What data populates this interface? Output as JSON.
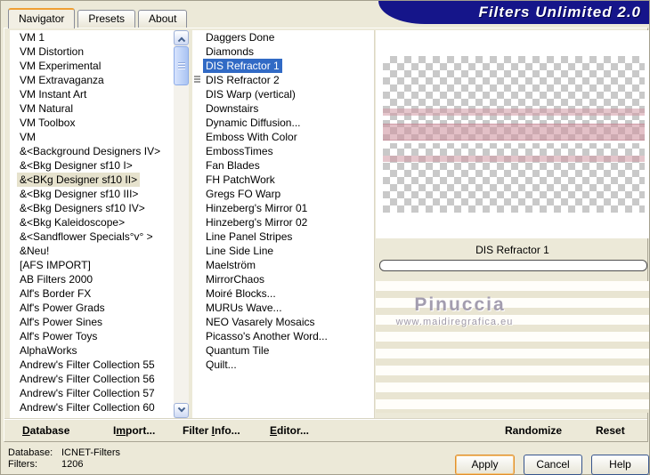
{
  "window": {
    "banner_title": "Filters Unlimited 2.0",
    "tabs": [
      {
        "label": "Navigator",
        "active": true
      },
      {
        "label": "Presets",
        "active": false
      },
      {
        "label": "About",
        "active": false
      }
    ]
  },
  "navigator": {
    "categories": {
      "items": [
        "VM 1",
        "VM Distortion",
        "VM Experimental",
        "VM Extravaganza",
        "VM Instant Art",
        "VM Natural",
        "VM Toolbox",
        "VM",
        "&<Background Designers IV>",
        "&<Bkg Designer sf10 I>",
        {
          "label": "&<BKg Designer sf10 II>",
          "selected": true
        },
        "&<Bkg Designer sf10 III>",
        "&<Bkg Designers sf10 IV>",
        "&<Bkg Kaleidoscope>",
        "&<Sandflower Specials°v° >",
        "&Neu!",
        "[AFS IMPORT]",
        "AB Filters 2000",
        "Alf's Border FX",
        "Alf's Power Grads",
        "Alf's Power Sines",
        "Alf's Power Toys",
        "AlphaWorks",
        "Andrew's Filter Collection 55",
        "Andrew's Filter Collection 56",
        "Andrew's Filter Collection 57",
        "Andrew's Filter Collection 60"
      ]
    },
    "filters": {
      "items": [
        "Daggers Done",
        "Diamonds",
        {
          "label": "DIS Refractor 1",
          "selected": true
        },
        {
          "label": "DIS Refractor 2",
          "grip": true
        },
        "DIS Warp (vertical)",
        "Downstairs",
        "Dynamic Diffusion...",
        "Emboss With Color",
        "EmbossTimes",
        "Fan Blades",
        "FH PatchWork",
        "Gregs FO Warp",
        "Hinzeberg's Mirror 01",
        "Hinzeberg's Mirror 02",
        "Line Panel Stripes",
        "Line Side Line",
        "Maelström",
        "MirrorChaos",
        "Moiré Blocks...",
        "MURUs Wave...",
        "NEO Vasarely Mosaics",
        "Picasso's Another Word...",
        "Quantum Tile",
        "Quilt..."
      ]
    },
    "preview": {
      "filter_name": "DIS Refractor 1",
      "watermark_title": "Pinuccia",
      "watermark_url": "www.maidiregrafica.eu"
    },
    "toolbar": {
      "database": {
        "pre": "",
        "key": "D",
        "post": "atabase"
      },
      "import": {
        "pre": "I",
        "key": "m",
        "post": "port..."
      },
      "filter_info": {
        "pre": "Filter ",
        "key": "I",
        "post": "nfo..."
      },
      "editor": {
        "pre": "",
        "key": "E",
        "post": "ditor..."
      },
      "randomize": "Randomize",
      "reset": "Reset"
    }
  },
  "status": {
    "database_label": "Database:",
    "database_value": "ICNET-Filters",
    "filters_label": "Filters:",
    "filters_value": "1206"
  },
  "buttons": {
    "apply": "Apply",
    "cancel": "Cancel",
    "help": "Help"
  },
  "colors": {
    "banner_navy": "#15158a",
    "selection_blue": "#316ac5",
    "inactive_selection_tan": "#e6e2cd",
    "tab_accent_orange": "#ef9f33",
    "stripe_pink": "#d098a3",
    "dialog_beige": "#ece9d8"
  }
}
